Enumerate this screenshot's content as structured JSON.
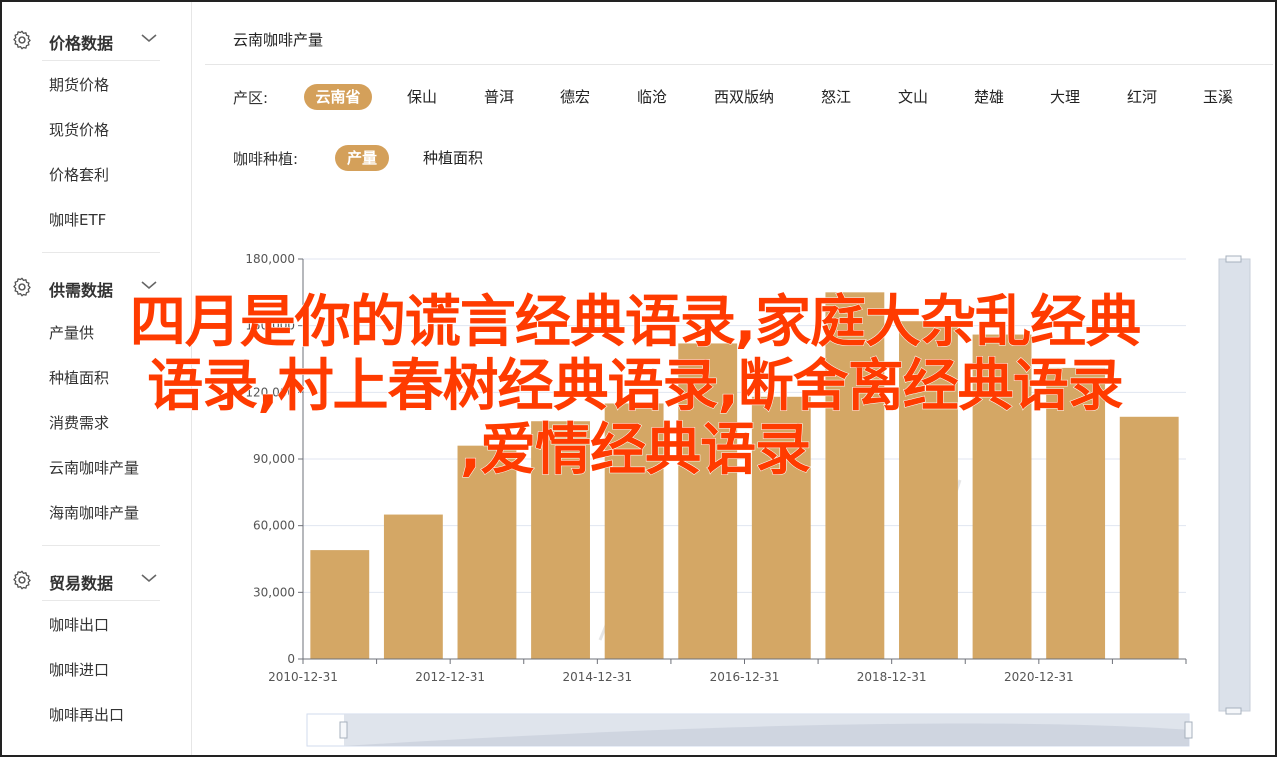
{
  "sidebar": {
    "groups": [
      {
        "title": "价格数据",
        "items": [
          "期货价格",
          "现货价格",
          "价格套利",
          "咖啡ETF"
        ]
      },
      {
        "title": "供需数据",
        "items": [
          "产量供",
          "种植面积",
          "消费需求",
          "云南咖啡产量",
          "海南咖啡产量"
        ]
      },
      {
        "title": "贸易数据",
        "items": [
          "咖啡出口",
          "咖啡进口",
          "咖啡再出口"
        ]
      }
    ]
  },
  "main": {
    "title": "云南咖啡产量",
    "region": {
      "label": "产区:",
      "options": [
        "云南省",
        "保山",
        "普洱",
        "德宏",
        "临沧",
        "西双版纳",
        "怒江",
        "文山",
        "楚雄",
        "大理",
        "红河",
        "玉溪"
      ],
      "active": "云南省"
    },
    "planting": {
      "label": "咖啡种植:",
      "options": [
        "产量",
        "种植面积"
      ],
      "active": "产量"
    }
  },
  "chart_data": {
    "type": "bar",
    "categories": [
      "2010-12-31",
      "2011-12-31",
      "2012-12-31",
      "2013-12-31",
      "2014-12-31",
      "2015-12-31",
      "2016-12-31",
      "2017-12-31",
      "2018-12-31",
      "2019-12-31",
      "2020-12-31",
      "2021-12-31"
    ],
    "x_tick_labels": [
      "2010-12-31",
      "2012-12-31",
      "2014-12-31",
      "2016-12-31",
      "2018-12-31",
      "2020-12-31"
    ],
    "values": [
      49000,
      65000,
      96000,
      107000,
      115000,
      142000,
      118000,
      165000,
      152000,
      146000,
      131000,
      109000
    ],
    "ylim": [
      0,
      180000
    ],
    "y_ticks": [
      "0",
      "30,000",
      "60,000",
      "90,000",
      "120,000",
      "150,000",
      "180,000"
    ],
    "grid": true,
    "colors": {
      "bar": "#d4a765",
      "axis": "#6e7079",
      "grid": "#e0e6f1",
      "slider": "#dbe1ea"
    }
  },
  "overlay": {
    "line1": "四月是你的谎言经典语录,家庭大杂乱经典",
    "line2": "语录,村上春树经典语录,断舍离经典语录",
    "line3": ",爱情经典语录"
  },
  "colors": {
    "accent": "#d4a05a",
    "overlay": "#ff3b00"
  }
}
